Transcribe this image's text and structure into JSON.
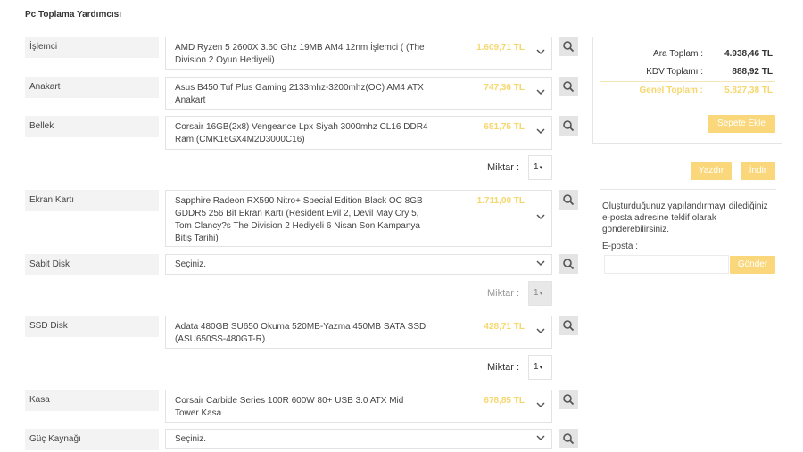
{
  "page": {
    "title": "Pc Toplama Yardımcısı"
  },
  "rows": [
    {
      "label": "İşlemci",
      "selected": "AMD Ryzen 5 2600X 3.60 Ghz 19MB AM4 12nm İşlemci ( (The Division 2 Oyun Hediyeli)",
      "price": "1.609,71 TL"
    },
    {
      "label": "Anakart",
      "selected": "Asus B450 Tuf Plus Gaming 2133mhz-3200mhz(OC) AM4 ATX Anakart",
      "price": "747,36 TL"
    },
    {
      "label": "Bellek",
      "selected": "Corsair 16GB(2x8) Vengeance Lpx Siyah 3000mhz CL16 DDR4 Ram (CMK16GX4M2D3000C16)",
      "price": "651,75 TL"
    },
    {
      "label": "Ekran Kartı",
      "selected": "Sapphire Radeon RX590 Nitro+ Special Edition Black OC 8GB GDDR5 256 Bit Ekran Kartı (Resident Evil 2, Devil May Cry 5, Tom Clancy?s The Division 2 Hediyeli 6 Nisan Son Kampanya Bitiş Tarihi)",
      "price": "1.711,00 TL"
    },
    {
      "label": "Sabit Disk",
      "selected": "Seçiniz.",
      "price": ""
    },
    {
      "label": "SSD Disk",
      "selected": "Adata 480GB SU650 Okuma 520MB-Yazma 450MB SATA SSD (ASU650SS-480GT-R)",
      "price": "428,71 TL"
    },
    {
      "label": "Kasa",
      "selected": "Corsair Carbide Series 100R 600W 80+ USB 3.0 ATX Mid Tower Kasa",
      "price": "678,85 TL"
    },
    {
      "label": "Güç Kaynağı",
      "selected": "Seçiniz.",
      "price": ""
    }
  ],
  "quantity": {
    "label": "Miktar :",
    "value": "1",
    "arrow": "▾"
  },
  "summary": {
    "subtotal_label": "Ara Toplam :",
    "subtotal": "4.938,46 TL",
    "vat_label": "KDV Toplamı :",
    "vat": "888,92 TL",
    "total_label": "Genel Toplam :",
    "total": "5.827,38 TL",
    "add_to_cart": "Sepete Ekle"
  },
  "actions": {
    "print": "Yazdır",
    "download": "İndir"
  },
  "email": {
    "info": "Oluşturduğunuz yapılandırmayı dilediğiniz e-posta adresine teklif olarak gönderebilirsiniz.",
    "label": "E-posta :",
    "placeholder": "",
    "send": "Gönder"
  },
  "colors": {
    "accent": "#f9d77a",
    "price": "#f5d76e"
  },
  "icons": {
    "search": "search-icon",
    "chevron": "chevron-down-icon"
  }
}
